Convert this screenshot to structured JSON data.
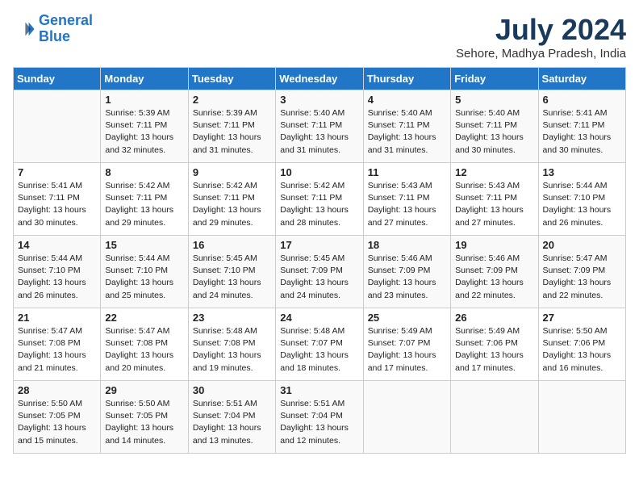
{
  "logo": {
    "line1": "General",
    "line2": "Blue"
  },
  "title": "July 2024",
  "location": "Sehore, Madhya Pradesh, India",
  "days_header": [
    "Sunday",
    "Monday",
    "Tuesday",
    "Wednesday",
    "Thursday",
    "Friday",
    "Saturday"
  ],
  "weeks": [
    [
      {
        "day": "",
        "sunrise": "",
        "sunset": "",
        "daylight": ""
      },
      {
        "day": "1",
        "sunrise": "Sunrise: 5:39 AM",
        "sunset": "Sunset: 7:11 PM",
        "daylight": "Daylight: 13 hours and 32 minutes."
      },
      {
        "day": "2",
        "sunrise": "Sunrise: 5:39 AM",
        "sunset": "Sunset: 7:11 PM",
        "daylight": "Daylight: 13 hours and 31 minutes."
      },
      {
        "day": "3",
        "sunrise": "Sunrise: 5:40 AM",
        "sunset": "Sunset: 7:11 PM",
        "daylight": "Daylight: 13 hours and 31 minutes."
      },
      {
        "day": "4",
        "sunrise": "Sunrise: 5:40 AM",
        "sunset": "Sunset: 7:11 PM",
        "daylight": "Daylight: 13 hours and 31 minutes."
      },
      {
        "day": "5",
        "sunrise": "Sunrise: 5:40 AM",
        "sunset": "Sunset: 7:11 PM",
        "daylight": "Daylight: 13 hours and 30 minutes."
      },
      {
        "day": "6",
        "sunrise": "Sunrise: 5:41 AM",
        "sunset": "Sunset: 7:11 PM",
        "daylight": "Daylight: 13 hours and 30 minutes."
      }
    ],
    [
      {
        "day": "7",
        "sunrise": "Sunrise: 5:41 AM",
        "sunset": "Sunset: 7:11 PM",
        "daylight": "Daylight: 13 hours and 30 minutes."
      },
      {
        "day": "8",
        "sunrise": "Sunrise: 5:42 AM",
        "sunset": "Sunset: 7:11 PM",
        "daylight": "Daylight: 13 hours and 29 minutes."
      },
      {
        "day": "9",
        "sunrise": "Sunrise: 5:42 AM",
        "sunset": "Sunset: 7:11 PM",
        "daylight": "Daylight: 13 hours and 29 minutes."
      },
      {
        "day": "10",
        "sunrise": "Sunrise: 5:42 AM",
        "sunset": "Sunset: 7:11 PM",
        "daylight": "Daylight: 13 hours and 28 minutes."
      },
      {
        "day": "11",
        "sunrise": "Sunrise: 5:43 AM",
        "sunset": "Sunset: 7:11 PM",
        "daylight": "Daylight: 13 hours and 27 minutes."
      },
      {
        "day": "12",
        "sunrise": "Sunrise: 5:43 AM",
        "sunset": "Sunset: 7:11 PM",
        "daylight": "Daylight: 13 hours and 27 minutes."
      },
      {
        "day": "13",
        "sunrise": "Sunrise: 5:44 AM",
        "sunset": "Sunset: 7:10 PM",
        "daylight": "Daylight: 13 hours and 26 minutes."
      }
    ],
    [
      {
        "day": "14",
        "sunrise": "Sunrise: 5:44 AM",
        "sunset": "Sunset: 7:10 PM",
        "daylight": "Daylight: 13 hours and 26 minutes."
      },
      {
        "day": "15",
        "sunrise": "Sunrise: 5:44 AM",
        "sunset": "Sunset: 7:10 PM",
        "daylight": "Daylight: 13 hours and 25 minutes."
      },
      {
        "day": "16",
        "sunrise": "Sunrise: 5:45 AM",
        "sunset": "Sunset: 7:10 PM",
        "daylight": "Daylight: 13 hours and 24 minutes."
      },
      {
        "day": "17",
        "sunrise": "Sunrise: 5:45 AM",
        "sunset": "Sunset: 7:09 PM",
        "daylight": "Daylight: 13 hours and 24 minutes."
      },
      {
        "day": "18",
        "sunrise": "Sunrise: 5:46 AM",
        "sunset": "Sunset: 7:09 PM",
        "daylight": "Daylight: 13 hours and 23 minutes."
      },
      {
        "day": "19",
        "sunrise": "Sunrise: 5:46 AM",
        "sunset": "Sunset: 7:09 PM",
        "daylight": "Daylight: 13 hours and 22 minutes."
      },
      {
        "day": "20",
        "sunrise": "Sunrise: 5:47 AM",
        "sunset": "Sunset: 7:09 PM",
        "daylight": "Daylight: 13 hours and 22 minutes."
      }
    ],
    [
      {
        "day": "21",
        "sunrise": "Sunrise: 5:47 AM",
        "sunset": "Sunset: 7:08 PM",
        "daylight": "Daylight: 13 hours and 21 minutes."
      },
      {
        "day": "22",
        "sunrise": "Sunrise: 5:47 AM",
        "sunset": "Sunset: 7:08 PM",
        "daylight": "Daylight: 13 hours and 20 minutes."
      },
      {
        "day": "23",
        "sunrise": "Sunrise: 5:48 AM",
        "sunset": "Sunset: 7:08 PM",
        "daylight": "Daylight: 13 hours and 19 minutes."
      },
      {
        "day": "24",
        "sunrise": "Sunrise: 5:48 AM",
        "sunset": "Sunset: 7:07 PM",
        "daylight": "Daylight: 13 hours and 18 minutes."
      },
      {
        "day": "25",
        "sunrise": "Sunrise: 5:49 AM",
        "sunset": "Sunset: 7:07 PM",
        "daylight": "Daylight: 13 hours and 17 minutes."
      },
      {
        "day": "26",
        "sunrise": "Sunrise: 5:49 AM",
        "sunset": "Sunset: 7:06 PM",
        "daylight": "Daylight: 13 hours and 17 minutes."
      },
      {
        "day": "27",
        "sunrise": "Sunrise: 5:50 AM",
        "sunset": "Sunset: 7:06 PM",
        "daylight": "Daylight: 13 hours and 16 minutes."
      }
    ],
    [
      {
        "day": "28",
        "sunrise": "Sunrise: 5:50 AM",
        "sunset": "Sunset: 7:05 PM",
        "daylight": "Daylight: 13 hours and 15 minutes."
      },
      {
        "day": "29",
        "sunrise": "Sunrise: 5:50 AM",
        "sunset": "Sunset: 7:05 PM",
        "daylight": "Daylight: 13 hours and 14 minutes."
      },
      {
        "day": "30",
        "sunrise": "Sunrise: 5:51 AM",
        "sunset": "Sunset: 7:04 PM",
        "daylight": "Daylight: 13 hours and 13 minutes."
      },
      {
        "day": "31",
        "sunrise": "Sunrise: 5:51 AM",
        "sunset": "Sunset: 7:04 PM",
        "daylight": "Daylight: 13 hours and 12 minutes."
      },
      {
        "day": "",
        "sunrise": "",
        "sunset": "",
        "daylight": ""
      },
      {
        "day": "",
        "sunrise": "",
        "sunset": "",
        "daylight": ""
      },
      {
        "day": "",
        "sunrise": "",
        "sunset": "",
        "daylight": ""
      }
    ]
  ]
}
